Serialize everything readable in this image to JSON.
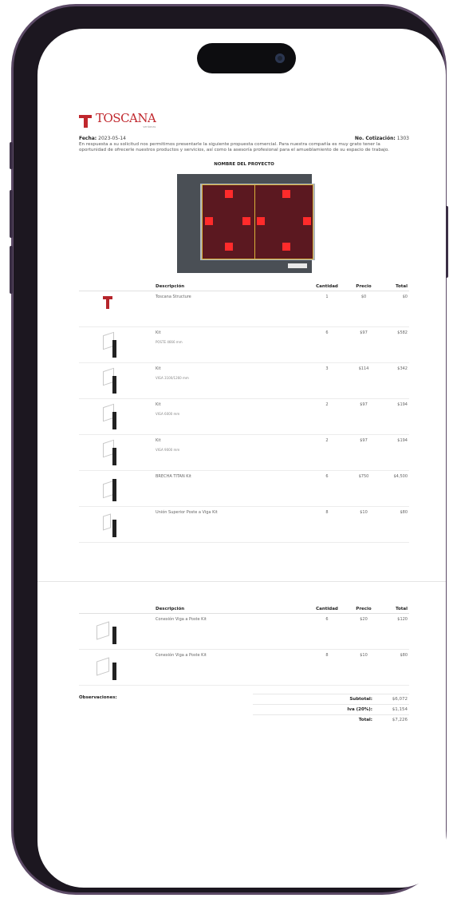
{
  "brand": {
    "name": "TOSCANA",
    "tagline": "ventanas"
  },
  "meta": {
    "fecha_label": "Fecha:",
    "fecha_value": "2023-05-14",
    "cotizacion_label": "No. Cotización:",
    "cotizacion_value": "1303"
  },
  "intro": "En respuesta a su solicitud nos permitimos presentarle la siguiente propuesta comercial. Para nuestra compañía es muy grato tener la oportunidad de ofrecerle nuestros productos y servicios, así como la asesoría profesional para el amueblamiento de su espacio de trabajo.",
  "project_title": "NOMBRE DEL PROYECTO",
  "table": {
    "headers": {
      "descripcion": "Descripción",
      "cantidad": "Cantidad",
      "precio": "Precio",
      "total": "Total"
    },
    "rows": [
      {
        "desc": "Toscana Structure",
        "sub": "",
        "qty": "1",
        "price": "$0",
        "total": "$0"
      },
      {
        "desc": "Kit",
        "sub": "POSTE 4666 mm",
        "qty": "6",
        "price": "$97",
        "total": "$582"
      },
      {
        "desc": "Kit",
        "sub": "VIGA 3100/1260 mm",
        "qty": "3",
        "price": "$114",
        "total": "$342"
      },
      {
        "desc": "Kit",
        "sub": "VIGA 6000 mm",
        "qty": "2",
        "price": "$97",
        "total": "$194"
      },
      {
        "desc": "Kit",
        "sub": "VIGA 9000 mm",
        "qty": "2",
        "price": "$97",
        "total": "$194"
      },
      {
        "desc": "BRECHA TITAN Kit",
        "sub": "",
        "qty": "6",
        "price": "$750",
        "total": "$4,500"
      },
      {
        "desc": "Unión Superior Poste a Viga Kit",
        "sub": "",
        "qty": "8",
        "price": "$10",
        "total": "$80"
      }
    ]
  },
  "table2": {
    "headers": {
      "descripcion": "Descripción",
      "cantidad": "Cantidad",
      "precio": "Precio",
      "total": "Total"
    },
    "rows": [
      {
        "desc": "Conexión Viga a Poste Kit",
        "sub": "",
        "qty": "6",
        "price": "$20",
        "total": "$120"
      },
      {
        "desc": "Conexión Viga a Poste Kit",
        "sub": "",
        "qty": "8",
        "price": "$10",
        "total": "$80"
      }
    ]
  },
  "totals": {
    "observaciones_label": "Observaciones:",
    "subtotal_label": "Subtotal:",
    "subtotal_value": "$6,072",
    "iva_label": "Iva (20%):",
    "iva_value": "$1,154",
    "total_label": "Total:",
    "total_value": "$7,226"
  }
}
